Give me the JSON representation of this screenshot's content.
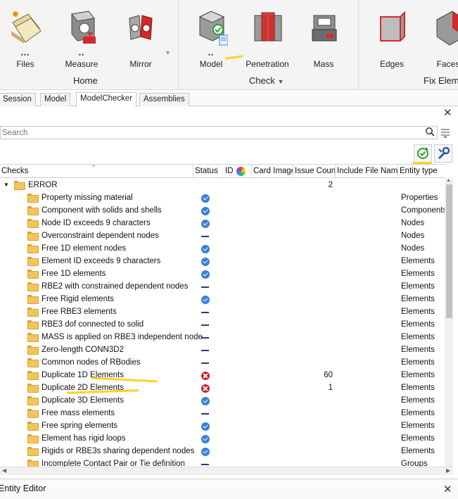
{
  "ribbon": {
    "buttons": [
      {
        "label": "Files",
        "icon": "files-icon"
      },
      {
        "label": "Measure",
        "icon": "measure-icon"
      },
      {
        "label": "Mirror",
        "icon": "mirror-icon"
      },
      {
        "label": "Model",
        "icon": "model-check-icon"
      },
      {
        "label": "Penetration",
        "icon": "penetration-icon"
      },
      {
        "label": "Mass",
        "icon": "mass-scale-icon"
      },
      {
        "label": "Edges",
        "icon": "edges-icon"
      },
      {
        "label": "Faces",
        "icon": "faces-icon"
      }
    ],
    "groups": {
      "home": "Home",
      "check": "Check",
      "fix": "Fix Eleme"
    }
  },
  "tabs": [
    {
      "label": "Session"
    },
    {
      "label": "Model"
    },
    {
      "label": "ModelChecker",
      "active": true
    },
    {
      "label": "Assemblies"
    }
  ],
  "search": {
    "placeholder": "Search"
  },
  "columns": {
    "checks": "Checks",
    "status": "Status",
    "id": "ID",
    "card_image": "Card Image",
    "issue_count": "Issue Count",
    "include_file": "Include File Name",
    "entity_type": "Entity type"
  },
  "tree": {
    "root": {
      "name": "ERROR",
      "issue_count": "2"
    },
    "rows": [
      {
        "name": "Property missing material",
        "status": "ok",
        "count": "",
        "entity": "Properties"
      },
      {
        "name": "Component with solids and shells",
        "status": "ok",
        "count": "",
        "entity": "Components"
      },
      {
        "name": "Node ID exceeds 9 characters",
        "status": "ok",
        "count": "",
        "entity": "Nodes"
      },
      {
        "name": "Overconstraint dependent nodes",
        "status": "na",
        "count": "",
        "entity": "Nodes"
      },
      {
        "name": "Free 1D element nodes",
        "status": "ok",
        "count": "",
        "entity": "Nodes"
      },
      {
        "name": "Element ID exceeds 9 characters",
        "status": "ok",
        "count": "",
        "entity": "Elements"
      },
      {
        "name": "Free 1D elements",
        "status": "ok",
        "count": "",
        "entity": "Elements"
      },
      {
        "name": "RBE2 with constrained dependent nodes",
        "status": "na",
        "count": "",
        "entity": "Elements"
      },
      {
        "name": "Free Rigid elements",
        "status": "ok",
        "count": "",
        "entity": "Elements"
      },
      {
        "name": "Free RBE3 elements",
        "status": "na",
        "count": "",
        "entity": "Elements"
      },
      {
        "name": "RBE3 dof connected to solid",
        "status": "na",
        "count": "",
        "entity": "Elements"
      },
      {
        "name": "MASS is applied on RBE3 independent node",
        "status": "na",
        "count": "",
        "entity": "Elements"
      },
      {
        "name": "Zero-length CONN3D2",
        "status": "na",
        "count": "",
        "entity": "Elements"
      },
      {
        "name": "Common nodes of RBodies",
        "status": "na",
        "count": "",
        "entity": "Elements"
      },
      {
        "name": "Duplicate 1D Elements",
        "status": "err",
        "count": "60",
        "entity": "Elements"
      },
      {
        "name": "Duplicate 2D Elements",
        "status": "err",
        "count": "1",
        "entity": "Elements"
      },
      {
        "name": "Duplicate 3D Elements",
        "status": "ok",
        "count": "",
        "entity": "Elements"
      },
      {
        "name": "Free mass elements",
        "status": "na",
        "count": "",
        "entity": "Elements"
      },
      {
        "name": "Free spring elements",
        "status": "ok",
        "count": "",
        "entity": "Elements"
      },
      {
        "name": "Element has rigid loops",
        "status": "ok",
        "count": "",
        "entity": "Elements"
      },
      {
        "name": "Rigids or RBE3s sharing dependent nodes",
        "status": "ok",
        "count": "",
        "entity": "Elements"
      },
      {
        "name": "Incomplete Contact Pair or Tie definition",
        "status": "na",
        "count": "",
        "entity": "Groups"
      }
    ]
  },
  "bottom_panel": {
    "title": "Entity Editor"
  },
  "colors": {
    "ok": "#3a80d6",
    "error": "#c8232c",
    "na": "#2a3a78",
    "folder": "#f2c55c",
    "highlight": "#ffd21f",
    "refresh": "#2e9e3a"
  }
}
